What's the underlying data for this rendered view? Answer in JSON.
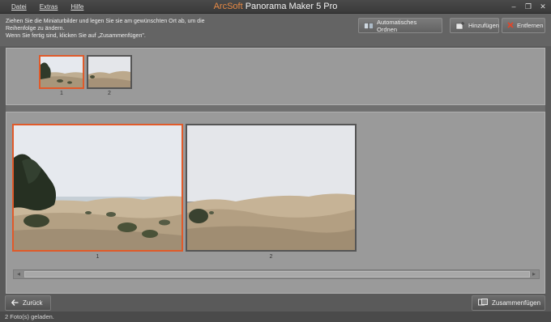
{
  "menu": {
    "items": [
      "Datei",
      "Extras",
      "Hilfe"
    ]
  },
  "app": {
    "brand": "ArcSoft",
    "title": "Panorama Maker 5 Pro"
  },
  "instructions": {
    "line1": "Ziehen Sie die Miniaturbilder und legen Sie sie am gewünschten Ort ab, um die",
    "line2": "Reihenfolge zu ändern.",
    "line3": "Wenn Sie fertig sind, klicken Sie auf „Zusammenfügen\"."
  },
  "toolbar": {
    "auto_arrange": "Automatisches Ordnen",
    "add": "Hinzufügen",
    "remove": "Entfernen"
  },
  "thumbnails": [
    {
      "num": "1",
      "selected": true
    },
    {
      "num": "2",
      "selected": false
    }
  ],
  "photos": [
    {
      "num": "1",
      "selected": true
    },
    {
      "num": "2",
      "selected": false
    }
  ],
  "nav": {
    "back": "Zurück",
    "merge": "Zusammenfügen"
  },
  "status": {
    "text": "2 Foto(s) geladen."
  },
  "colors": {
    "accent": "#e05a2a",
    "brand": "#e88a45"
  }
}
